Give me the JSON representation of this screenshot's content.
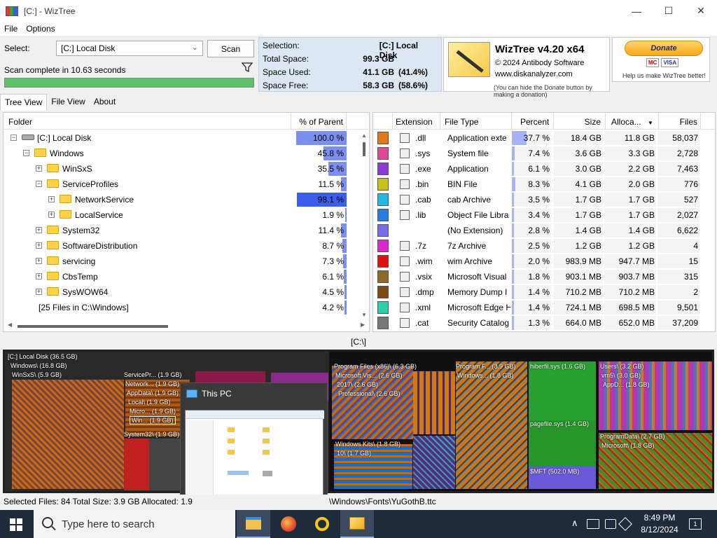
{
  "window": {
    "title": "[C:] - WizTree",
    "minimize": "—",
    "maximize": "☐",
    "close": "✕"
  },
  "menu": [
    "File",
    "Options"
  ],
  "top": {
    "select_label": "Select:",
    "drive_value": "[C:] Local Disk",
    "scan_label": "Scan",
    "scan_status": "Scan complete in 10.63 seconds",
    "progress_fraction": 1.0,
    "progress_color": "#5cbf6a"
  },
  "selection": {
    "selection_label": "Selection:",
    "selection_value": "[C:]  Local Disk",
    "total_label": "Total Space:",
    "total_value": "99.3 GB",
    "used_label": "Space Used:",
    "used_value": "41.1 GB",
    "used_pct": "(41.4%)",
    "free_label": "Space Free:",
    "free_value": "58.3 GB",
    "free_pct": "(58.6%)"
  },
  "logo": {
    "title": "WizTree v4.20 x64",
    "copyright": "© 2024 Antibody Software",
    "site": "www.diskanalyzer.com",
    "note": "(You can hide the Donate button by making a donation)"
  },
  "donate": {
    "button": "Donate",
    "card1": "MC",
    "card2": "VISA",
    "note": "Help us make WizTree better!"
  },
  "tabs": [
    "Tree View",
    "File View",
    "About"
  ],
  "tree": {
    "col_folder": "Folder",
    "col_pct": "% of Parent",
    "rows": [
      {
        "name": "[C:] Local Disk",
        "pct": "100.0 %",
        "fill": 1.0,
        "indent": 0,
        "kind": "drive",
        "exp": "−"
      },
      {
        "name": "Windows",
        "pct": "45.8 %",
        "fill": 0.458,
        "indent": 1,
        "kind": "folder",
        "exp": "−"
      },
      {
        "name": "WinSxS",
        "pct": "35.5 %",
        "fill": 0.355,
        "indent": 2,
        "kind": "folder",
        "exp": "+"
      },
      {
        "name": "ServiceProfiles",
        "pct": "11.5 %",
        "fill": 0.115,
        "indent": 2,
        "kind": "folder",
        "exp": "−"
      },
      {
        "name": "NetworkService",
        "pct": "98.1 %",
        "fill": 0.981,
        "indent": 3,
        "kind": "folder",
        "exp": "+",
        "selected": true
      },
      {
        "name": "LocalService",
        "pct": "1.9 %",
        "fill": 0.019,
        "indent": 3,
        "kind": "folder",
        "exp": "+"
      },
      {
        "name": "System32",
        "pct": "11.4 %",
        "fill": 0.114,
        "indent": 2,
        "kind": "folder",
        "exp": "+"
      },
      {
        "name": "SoftwareDistribution",
        "pct": "8.7 %",
        "fill": 0.087,
        "indent": 2,
        "kind": "folder",
        "exp": "+"
      },
      {
        "name": "servicing",
        "pct": "7.3 %",
        "fill": 0.073,
        "indent": 2,
        "kind": "folder",
        "exp": "+"
      },
      {
        "name": "CbsTemp",
        "pct": "6.1 %",
        "fill": 0.061,
        "indent": 2,
        "kind": "folder",
        "exp": "+"
      },
      {
        "name": "SysWOW64",
        "pct": "4.5 %",
        "fill": 0.045,
        "indent": 2,
        "kind": "folder",
        "exp": "+"
      },
      {
        "name": "[25 Files in C:\\Windows]",
        "pct": "4.2 %",
        "fill": 0.042,
        "indent": 2,
        "kind": "files",
        "exp": ""
      }
    ]
  },
  "ext": {
    "headers": [
      "Extension",
      "File Type",
      "Percent",
      "Size",
      "Alloca...",
      "Files"
    ],
    "sort_arrow": "▼",
    "rows": [
      {
        "color": "#e07a12",
        "ext": ".dll",
        "type": "Application exte",
        "pct": "37.7 %",
        "fill": 0.377,
        "size": "18.4 GB",
        "alloc": "11.8 GB",
        "files": "58,037"
      },
      {
        "color": "#e04898",
        "ext": ".sys",
        "type": "System file",
        "pct": "7.4 %",
        "fill": 0.074,
        "size": "3.6 GB",
        "alloc": "3.3 GB",
        "files": "2,728"
      },
      {
        "color": "#8a3ad9",
        "ext": ".exe",
        "type": "Application",
        "pct": "6.1 %",
        "fill": 0.061,
        "size": "3.0 GB",
        "alloc": "2.2 GB",
        "files": "7,463"
      },
      {
        "color": "#c9c21a",
        "ext": ".bin",
        "type": "BIN File",
        "pct": "8.3 %",
        "fill": 0.083,
        "size": "4.1 GB",
        "alloc": "2.0 GB",
        "files": "776"
      },
      {
        "color": "#22b8e0",
        "ext": ".cab",
        "type": "cab Archive",
        "pct": "3.5 %",
        "fill": 0.035,
        "size": "1.7 GB",
        "alloc": "1.7 GB",
        "files": "527"
      },
      {
        "color": "#2a7de0",
        "ext": ".lib",
        "type": "Object File Libra",
        "pct": "3.4 %",
        "fill": 0.034,
        "size": "1.7 GB",
        "alloc": "1.7 GB",
        "files": "2,027"
      },
      {
        "color": "#7a6be8",
        "ext": "",
        "type": "(No Extension)",
        "pct": "2.8 %",
        "fill": 0.028,
        "size": "1.4 GB",
        "alloc": "1.4 GB",
        "files": "6,622"
      },
      {
        "color": "#d92ad0",
        "ext": ".7z",
        "type": "7z Archive",
        "pct": "2.5 %",
        "fill": 0.025,
        "size": "1.2 GB",
        "alloc": "1.2 GB",
        "files": "4"
      },
      {
        "color": "#e01010",
        "ext": ".wim",
        "type": "wim Archive",
        "pct": "2.0 %",
        "fill": 0.02,
        "size": "983.9 MB",
        "alloc": "947.7 MB",
        "files": "15"
      },
      {
        "color": "#8a6a2a",
        "ext": ".vsix",
        "type": "Microsoft Visual",
        "pct": "1.8 %",
        "fill": 0.018,
        "size": "903.1 MB",
        "alloc": "903.7 MB",
        "files": "315"
      },
      {
        "color": "#7a4a12",
        "ext": ".dmp",
        "type": "Memory Dump I",
        "pct": "1.4 %",
        "fill": 0.014,
        "size": "710.2 MB",
        "alloc": "710.2 MB",
        "files": "2"
      },
      {
        "color": "#2ad0a8",
        "ext": ".xml",
        "type": "Microsoft Edge H",
        "pct": "1.4 %",
        "fill": 0.014,
        "size": "724.1 MB",
        "alloc": "698.5 MB",
        "files": "9,501"
      },
      {
        "color": "#777777",
        "ext": ".cat",
        "type": "Security Catalog",
        "pct": "1.3 %",
        "fill": 0.013,
        "size": "664.0 MB",
        "alloc": "652.0 MB",
        "files": "37,209"
      }
    ]
  },
  "path_label": "[C:\\]",
  "treemap": {
    "labels": {
      "root": "[C:] Local Disk (36.5 GB)",
      "windows": "Windows\\ (16.8 GB)",
      "winsxs": "WinSxS\\ (5.9 GB)",
      "servicepr": "ServicePr... (1.9 GB)",
      "network": "Network... (1.9 GB)",
      "appdata": "AppData\\ (1.9 GB)",
      "local": "Local\\ (1.9 GB)",
      "micro": "Micro... (1.9 GB)",
      "win": "Win... (1.9 GB)",
      "system32": "System32\\ (1.9 GB)",
      "pfx86": "Program Files (x86)\\ (6.3 GB)",
      "msvis": "Microsoft Vis... (2.6 GB)",
      "y2017": "2017\\ (2.6 GB)",
      "professional": "Professional\\ (2.6 GB)",
      "winkits": "Windows Kits\\ (1.8 GB)",
      "ten": "10\\ (1.7 GB)",
      "progf": "Program F... (3.9 GB)",
      "windowsk": "Windows... (1.8 GB)",
      "hiberfil": "hiberfil.sys (1.6 GB)",
      "pagefile": "pagefile.sys (1.4 GB)",
      "mft": "$MFT (502.0 MB)",
      "users": "Users\\ (3.2 GB)",
      "vm5": "vm5\\ (3.0 GB)",
      "appd": "AppD... (1.8 GB)",
      "progdata": "ProgramData\\ (2.7 GB)",
      "microsoftpd": "Microsoft\\ (1.8 GB)"
    }
  },
  "thumbnail": {
    "title": "This PC"
  },
  "status": {
    "left": "Selected Files: 84  Total Size: 3.9 GB  Allocated: 1.9",
    "right": "\\Windows\\Fonts\\YuGothB.ttc"
  },
  "taskbar": {
    "search_placeholder": "Type here to search",
    "time": "8:49 PM",
    "date": "8/12/2024",
    "tray_chevron": "∧",
    "notif_count": "1"
  }
}
